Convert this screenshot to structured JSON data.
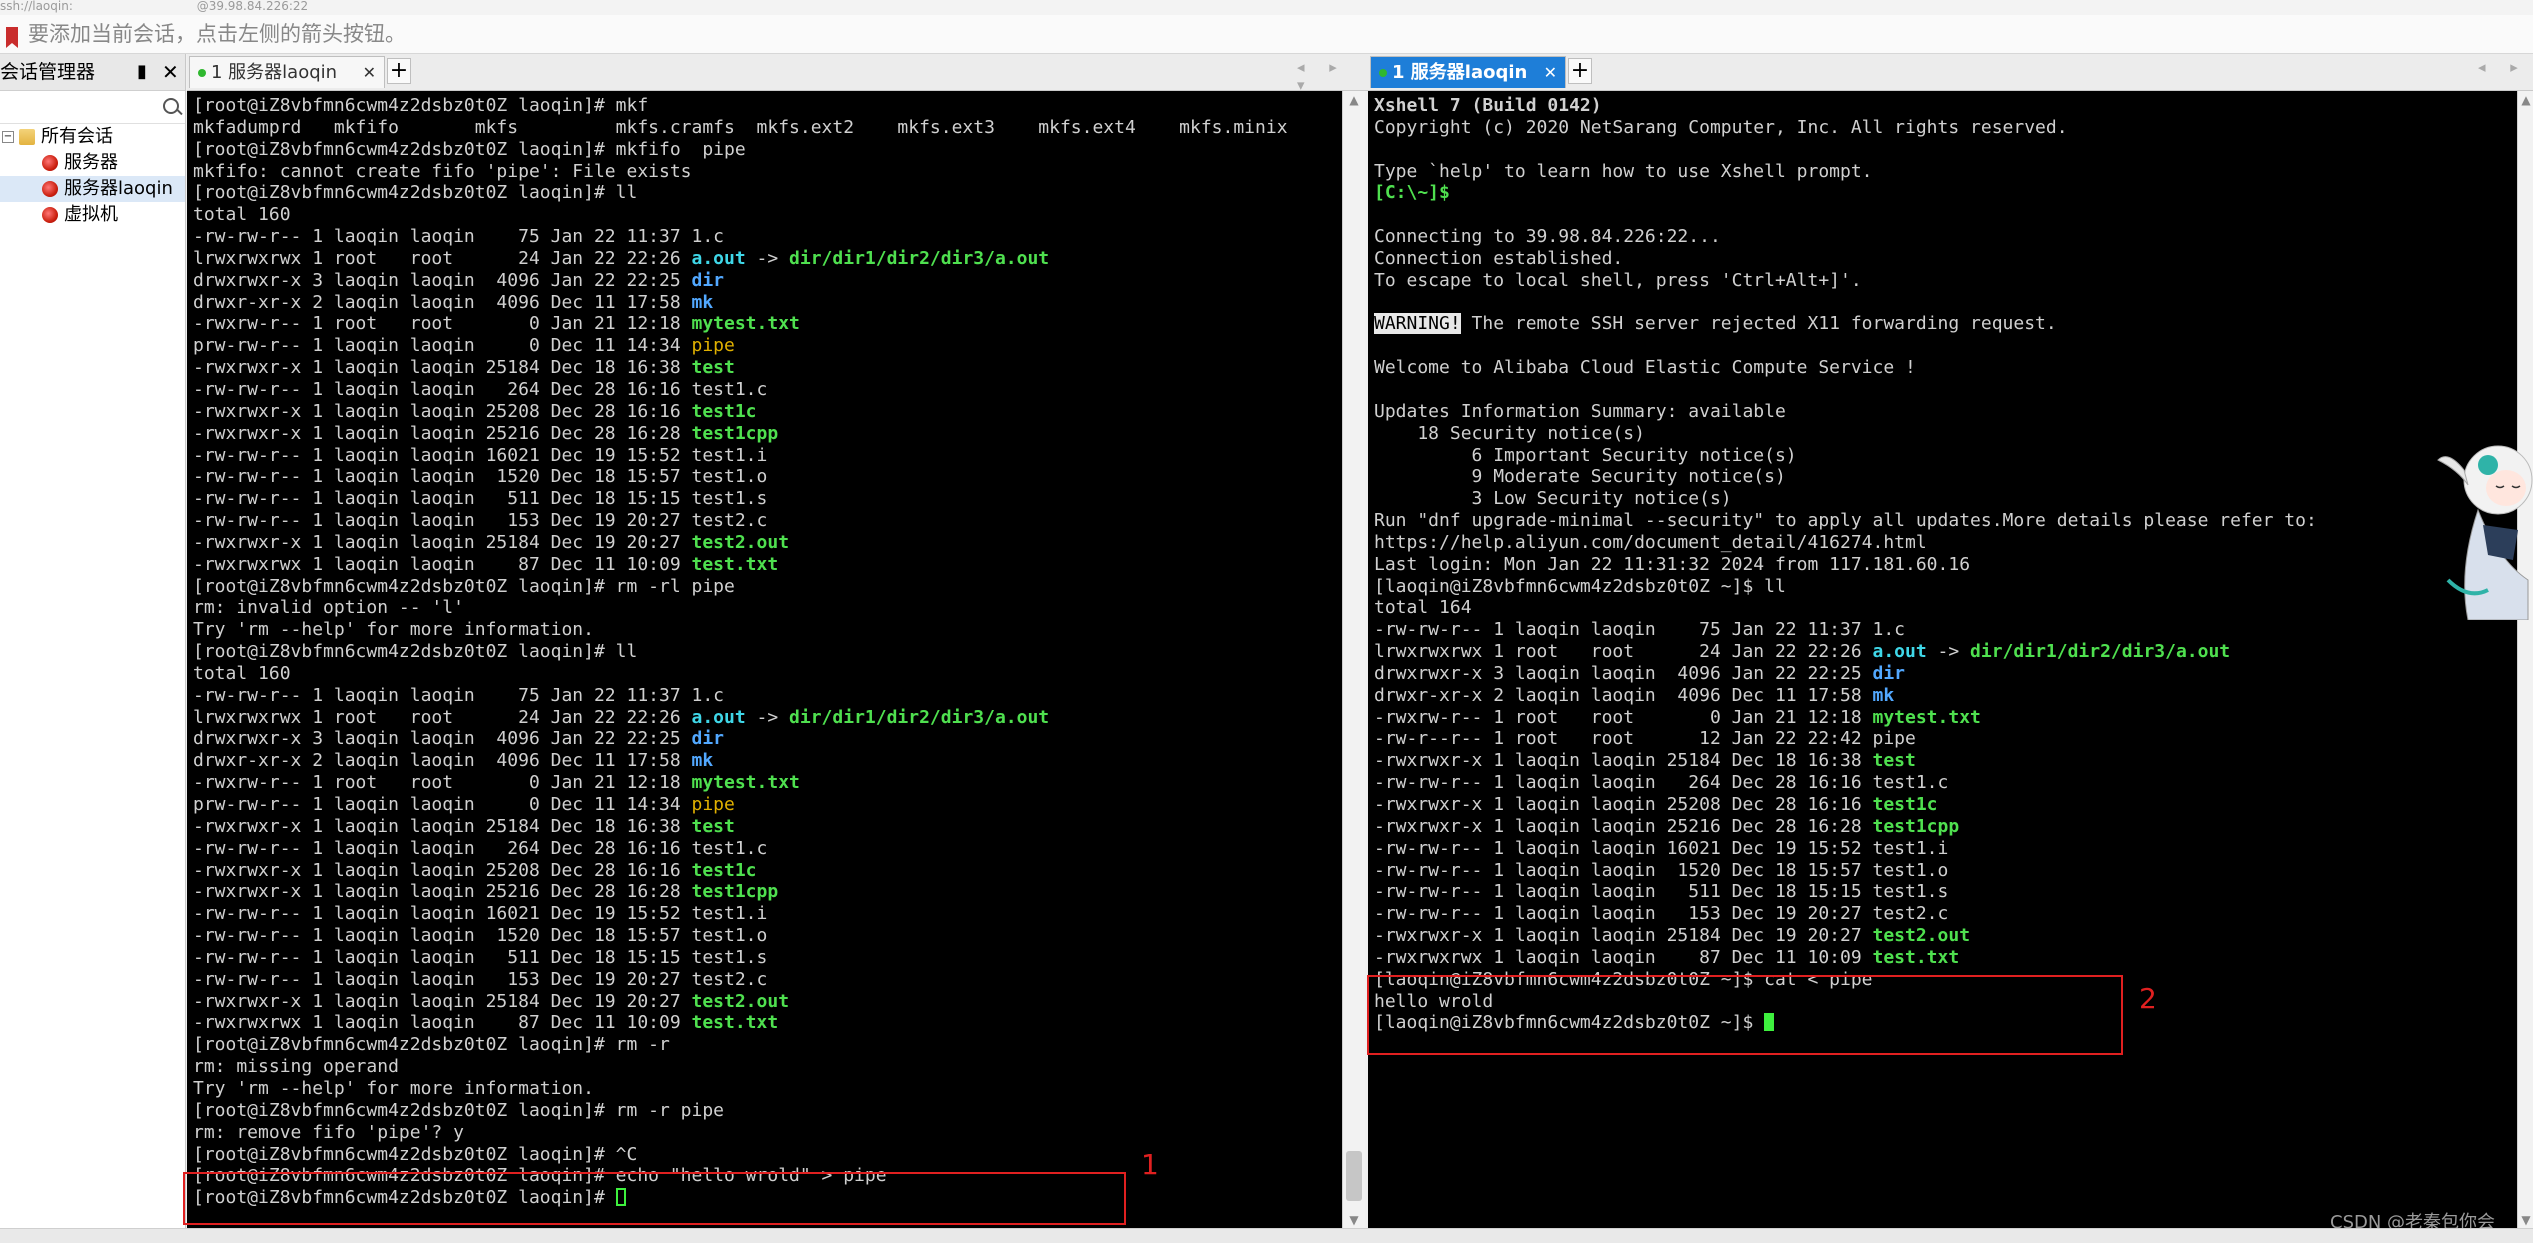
{
  "window": {
    "title_left": "ssh://laoqin:",
    "title_right": "@39.98.84.226:22"
  },
  "infobar": {
    "text": "要添加当前会话，点击左侧的箭头按钮。"
  },
  "sidebar": {
    "title": "会话管理器",
    "pin": "▮",
    "close": "✕",
    "root": "所有会话",
    "items": [
      "服务器",
      "服务器laoqin",
      "虚拟机"
    ],
    "selected": "服务器laoqin"
  },
  "left_pane": {
    "tab_label": "1 服务器laoqin",
    "tab_close": "✕",
    "plus": "+",
    "nav": "◂ ▸ ▾",
    "box_label": "1"
  },
  "right_pane": {
    "tab_label": "1 服务器laoqin",
    "tab_close": "✕",
    "plus": "+",
    "nav": "◂ ▸",
    "box_label": "2"
  },
  "left_terminal": {
    "lines": [
      [
        {
          "t": "[root@iZ8vbfmn6cwm4z2dsbz0t0Z laoqin]# mkf"
        }
      ],
      [
        {
          "t": "mkfadumprd   mkfifo       mkfs         mkfs.cramfs  mkfs.ext2    mkfs.ext3    mkfs.ext4    mkfs.minix"
        }
      ],
      [
        {
          "t": "[root@iZ8vbfmn6cwm4z2dsbz0t0Z laoqin]# mkfifo  pipe"
        }
      ],
      [
        {
          "t": "mkfifo: cannot create fifo 'pipe': File exists"
        }
      ],
      [
        {
          "t": "[root@iZ8vbfmn6cwm4z2dsbz0t0Z laoqin]# ll"
        }
      ],
      [
        {
          "t": "total 160"
        }
      ],
      [
        {
          "t": "-rw-rw-r-- 1 laoqin laoqin    75 Jan 22 11:37 1.c"
        }
      ],
      [
        {
          "t": "lrwxrwxrwx 1 root   root      24 Jan 22 22:26 "
        },
        {
          "t": "a.out",
          "c": "c"
        },
        {
          "t": " -> "
        },
        {
          "t": "dir/dir1/dir2/dir3/a.out",
          "c": "g"
        }
      ],
      [
        {
          "t": "drwxrwxr-x 3 laoqin laoqin  4096 Jan 22 22:25 "
        },
        {
          "t": "dir",
          "c": "bl"
        }
      ],
      [
        {
          "t": "drwxr-xr-x 2 laoqin laoqin  4096 Dec 11 17:58 "
        },
        {
          "t": "mk",
          "c": "bl"
        }
      ],
      [
        {
          "t": "-rwxrw-r-- 1 root   root       0 Jan 21 12:18 "
        },
        {
          "t": "mytest.txt",
          "c": "g"
        }
      ],
      [
        {
          "t": "prw-rw-r-- 1 laoqin laoqin     0 Dec 11 14:34 "
        },
        {
          "t": "pipe",
          "c": "y"
        }
      ],
      [
        {
          "t": "-rwxrwxr-x 1 laoqin laoqin 25184 Dec 18 16:38 "
        },
        {
          "t": "test",
          "c": "g"
        }
      ],
      [
        {
          "t": "-rw-rw-r-- 1 laoqin laoqin   264 Dec 28 16:16 test1.c"
        }
      ],
      [
        {
          "t": "-rwxrwxr-x 1 laoqin laoqin 25208 Dec 28 16:16 "
        },
        {
          "t": "test1c",
          "c": "g"
        }
      ],
      [
        {
          "t": "-rwxrwxr-x 1 laoqin laoqin 25216 Dec 28 16:28 "
        },
        {
          "t": "test1cpp",
          "c": "g"
        }
      ],
      [
        {
          "t": "-rw-rw-r-- 1 laoqin laoqin 16021 Dec 19 15:52 test1.i"
        }
      ],
      [
        {
          "t": "-rw-rw-r-- 1 laoqin laoqin  1520 Dec 18 15:57 test1.o"
        }
      ],
      [
        {
          "t": "-rw-rw-r-- 1 laoqin laoqin   511 Dec 18 15:15 test1.s"
        }
      ],
      [
        {
          "t": "-rw-rw-r-- 1 laoqin laoqin   153 Dec 19 20:27 test2.c"
        }
      ],
      [
        {
          "t": "-rwxrwxr-x 1 laoqin laoqin 25184 Dec 19 20:27 "
        },
        {
          "t": "test2.out",
          "c": "g"
        }
      ],
      [
        {
          "t": "-rwxrwxrwx 1 laoqin laoqin    87 Dec 11 10:09 "
        },
        {
          "t": "test.txt",
          "c": "g"
        }
      ],
      [
        {
          "t": "[root@iZ8vbfmn6cwm4z2dsbz0t0Z laoqin]# rm -rl pipe"
        }
      ],
      [
        {
          "t": "rm: invalid option -- 'l'"
        }
      ],
      [
        {
          "t": "Try 'rm --help' for more information."
        }
      ],
      [
        {
          "t": "[root@iZ8vbfmn6cwm4z2dsbz0t0Z laoqin]# ll"
        }
      ],
      [
        {
          "t": "total 160"
        }
      ],
      [
        {
          "t": "-rw-rw-r-- 1 laoqin laoqin    75 Jan 22 11:37 1.c"
        }
      ],
      [
        {
          "t": "lrwxrwxrwx 1 root   root      24 Jan 22 22:26 "
        },
        {
          "t": "a.out",
          "c": "c"
        },
        {
          "t": " -> "
        },
        {
          "t": "dir/dir1/dir2/dir3/a.out",
          "c": "g"
        }
      ],
      [
        {
          "t": "drwxrwxr-x 3 laoqin laoqin  4096 Jan 22 22:25 "
        },
        {
          "t": "dir",
          "c": "bl"
        }
      ],
      [
        {
          "t": "drwxr-xr-x 2 laoqin laoqin  4096 Dec 11 17:58 "
        },
        {
          "t": "mk",
          "c": "bl"
        }
      ],
      [
        {
          "t": "-rwxrw-r-- 1 root   root       0 Jan 21 12:18 "
        },
        {
          "t": "mytest.txt",
          "c": "g"
        }
      ],
      [
        {
          "t": "prw-rw-r-- 1 laoqin laoqin     0 Dec 11 14:34 "
        },
        {
          "t": "pipe",
          "c": "y"
        }
      ],
      [
        {
          "t": "-rwxrwxr-x 1 laoqin laoqin 25184 Dec 18 16:38 "
        },
        {
          "t": "test",
          "c": "g"
        }
      ],
      [
        {
          "t": "-rw-rw-r-- 1 laoqin laoqin   264 Dec 28 16:16 test1.c"
        }
      ],
      [
        {
          "t": "-rwxrwxr-x 1 laoqin laoqin 25208 Dec 28 16:16 "
        },
        {
          "t": "test1c",
          "c": "g"
        }
      ],
      [
        {
          "t": "-rwxrwxr-x 1 laoqin laoqin 25216 Dec 28 16:28 "
        },
        {
          "t": "test1cpp",
          "c": "g"
        }
      ],
      [
        {
          "t": "-rw-rw-r-- 1 laoqin laoqin 16021 Dec 19 15:52 test1.i"
        }
      ],
      [
        {
          "t": "-rw-rw-r-- 1 laoqin laoqin  1520 Dec 18 15:57 test1.o"
        }
      ],
      [
        {
          "t": "-rw-rw-r-- 1 laoqin laoqin   511 Dec 18 15:15 test1.s"
        }
      ],
      [
        {
          "t": "-rw-rw-r-- 1 laoqin laoqin   153 Dec 19 20:27 test2.c"
        }
      ],
      [
        {
          "t": "-rwxrwxr-x 1 laoqin laoqin 25184 Dec 19 20:27 "
        },
        {
          "t": "test2.out",
          "c": "g"
        }
      ],
      [
        {
          "t": "-rwxrwxrwx 1 laoqin laoqin    87 Dec 11 10:09 "
        },
        {
          "t": "test.txt",
          "c": "g"
        }
      ],
      [
        {
          "t": "[root@iZ8vbfmn6cwm4z2dsbz0t0Z laoqin]# rm -r"
        }
      ],
      [
        {
          "t": "rm: missing operand"
        }
      ],
      [
        {
          "t": "Try 'rm --help' for more information."
        }
      ],
      [
        {
          "t": "[root@iZ8vbfmn6cwm4z2dsbz0t0Z laoqin]# rm -r pipe"
        }
      ],
      [
        {
          "t": "rm: remove fifo 'pipe'? y"
        }
      ],
      [
        {
          "t": "[root@iZ8vbfmn6cwm4z2dsbz0t0Z laoqin]# ^C"
        }
      ],
      [
        {
          "t": "[root@iZ8vbfmn6cwm4z2dsbz0t0Z laoqin]# echo \"hello wrold\" > pipe"
        }
      ],
      [
        {
          "t": "[root@iZ8vbfmn6cwm4z2dsbz0t0Z laoqin]# "
        },
        {
          "cursor": "hollow"
        }
      ]
    ]
  },
  "right_terminal": {
    "lines": [
      [
        {
          "t": "Xshell 7 (Build 0142)",
          "c": "b"
        }
      ],
      [
        {
          "t": "Copyright (c) 2020 NetSarang Computer, Inc. All rights reserved."
        }
      ],
      [
        {
          "t": ""
        }
      ],
      [
        {
          "t": "Type `help' to learn how to use Xshell prompt."
        }
      ],
      [
        {
          "t": "[C:\\~]$ ",
          "c": "g"
        }
      ],
      [
        {
          "t": ""
        }
      ],
      [
        {
          "t": "Connecting to 39.98.84.226:22..."
        }
      ],
      [
        {
          "t": "Connection established."
        }
      ],
      [
        {
          "t": "To escape to local shell, press 'Ctrl+Alt+]'."
        }
      ],
      [
        {
          "t": ""
        }
      ],
      [
        {
          "t": "WARNING!",
          "c": "warn"
        },
        {
          "t": " The remote SSH server rejected X11 forwarding request."
        }
      ],
      [
        {
          "t": ""
        }
      ],
      [
        {
          "t": "Welcome to Alibaba Cloud Elastic Compute Service !"
        }
      ],
      [
        {
          "t": ""
        }
      ],
      [
        {
          "t": "Updates Information Summary: available"
        }
      ],
      [
        {
          "t": "    18 Security notice(s)"
        }
      ],
      [
        {
          "t": "         6 Important Security notice(s)"
        }
      ],
      [
        {
          "t": "         9 Moderate Security notice(s)"
        }
      ],
      [
        {
          "t": "         3 Low Security notice(s)"
        }
      ],
      [
        {
          "t": "Run \"dnf upgrade-minimal --security\" to apply all updates.More details please refer to:"
        }
      ],
      [
        {
          "t": "https://help.aliyun.com/document_detail/416274.html"
        }
      ],
      [
        {
          "t": "Last login: Mon Jan 22 11:31:32 2024 from 117.181.60.16"
        }
      ],
      [
        {
          "t": "[laoqin@iZ8vbfmn6cwm4z2dsbz0t0Z ~]$ ll"
        }
      ],
      [
        {
          "t": "total 164"
        }
      ],
      [
        {
          "t": "-rw-rw-r-- 1 laoqin laoqin    75 Jan 22 11:37 1.c"
        }
      ],
      [
        {
          "t": "lrwxrwxrwx 1 root   root      24 Jan 22 22:26 "
        },
        {
          "t": "a.out",
          "c": "c"
        },
        {
          "t": " -> "
        },
        {
          "t": "dir/dir1/dir2/dir3/a.out",
          "c": "g"
        }
      ],
      [
        {
          "t": "drwxrwxr-x 3 laoqin laoqin  4096 Jan 22 22:25 "
        },
        {
          "t": "dir",
          "c": "bl"
        }
      ],
      [
        {
          "t": "drwxr-xr-x 2 laoqin laoqin  4096 Dec 11 17:58 "
        },
        {
          "t": "mk",
          "c": "bl"
        }
      ],
      [
        {
          "t": "-rwxrw-r-- 1 root   root       0 Jan 21 12:18 "
        },
        {
          "t": "mytest.txt",
          "c": "g"
        }
      ],
      [
        {
          "t": "-rw-r--r-- 1 root   root      12 Jan 22 22:42 pipe"
        }
      ],
      [
        {
          "t": "-rwxrwxr-x 1 laoqin laoqin 25184 Dec 18 16:38 "
        },
        {
          "t": "test",
          "c": "g"
        }
      ],
      [
        {
          "t": "-rw-rw-r-- 1 laoqin laoqin   264 Dec 28 16:16 test1.c"
        }
      ],
      [
        {
          "t": "-rwxrwxr-x 1 laoqin laoqin 25208 Dec 28 16:16 "
        },
        {
          "t": "test1c",
          "c": "g"
        }
      ],
      [
        {
          "t": "-rwxrwxr-x 1 laoqin laoqin 25216 Dec 28 16:28 "
        },
        {
          "t": "test1cpp",
          "c": "g"
        }
      ],
      [
        {
          "t": "-rw-rw-r-- 1 laoqin laoqin 16021 Dec 19 15:52 test1.i"
        }
      ],
      [
        {
          "t": "-rw-rw-r-- 1 laoqin laoqin  1520 Dec 18 15:57 test1.o"
        }
      ],
      [
        {
          "t": "-rw-rw-r-- 1 laoqin laoqin   511 Dec 18 15:15 test1.s"
        }
      ],
      [
        {
          "t": "-rw-rw-r-- 1 laoqin laoqin   153 Dec 19 20:27 test2.c"
        }
      ],
      [
        {
          "t": "-rwxrwxr-x 1 laoqin laoqin 25184 Dec 19 20:27 "
        },
        {
          "t": "test2.out",
          "c": "g"
        }
      ],
      [
        {
          "t": "-rwxrwxrwx 1 laoqin laoqin    87 Dec 11 10:09 "
        },
        {
          "t": "test.txt",
          "c": "g"
        }
      ],
      [
        {
          "t": "[laoqin@iZ8vbfmn6cwm4z2dsbz0t0Z ~]$ cat < pipe"
        }
      ],
      [
        {
          "t": "hello wrold"
        }
      ],
      [
        {
          "t": "[laoqin@iZ8vbfmn6cwm4z2dsbz0t0Z ~]$ "
        },
        {
          "cursor": "solid"
        }
      ]
    ]
  },
  "watermark": "CSDN @老秦包你会"
}
